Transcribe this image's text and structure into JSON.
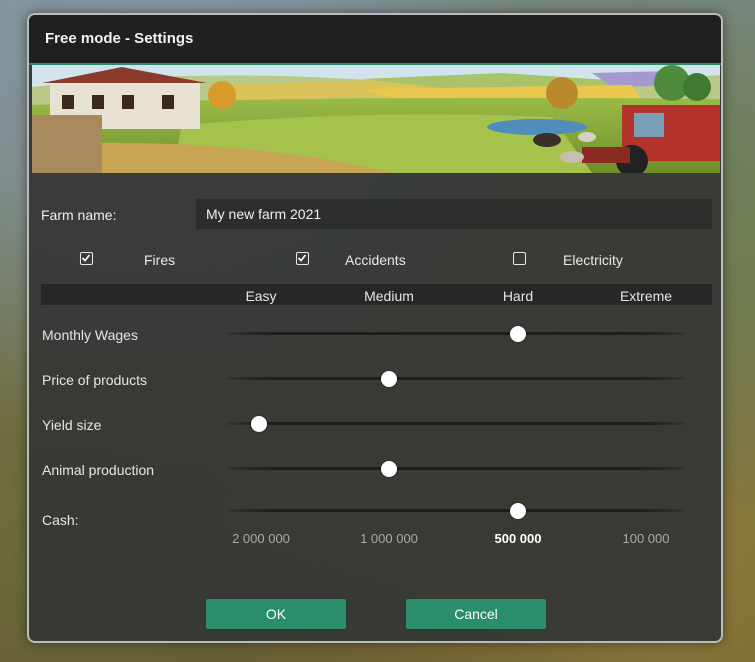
{
  "dialog": {
    "title": "Free mode - Settings",
    "farm_name_label": "Farm name:",
    "farm_name_value": "My new farm 2021"
  },
  "options": [
    {
      "label": "Fires",
      "checked": true
    },
    {
      "label": "Accidents",
      "checked": true
    },
    {
      "label": "Electricity",
      "checked": false
    }
  ],
  "difficulty_columns": [
    "Easy",
    "Medium",
    "Hard",
    "Extreme"
  ],
  "settings": [
    {
      "label": "Monthly Wages",
      "value": "Hard"
    },
    {
      "label": "Price of products",
      "value": "Medium"
    },
    {
      "label": "Yield size",
      "value": "Easy"
    },
    {
      "label": "Animal production",
      "value": "Medium"
    },
    {
      "label": "Cash:",
      "value": "500 000"
    }
  ],
  "cash_options": [
    "2 000 000",
    "1 000 000",
    "500 000",
    "100 000"
  ],
  "buttons": {
    "ok": "OK",
    "cancel": "Cancel"
  },
  "colors": {
    "accent": "#2a8e6c",
    "titlebar": "#1f2120",
    "panel": "#343634"
  }
}
